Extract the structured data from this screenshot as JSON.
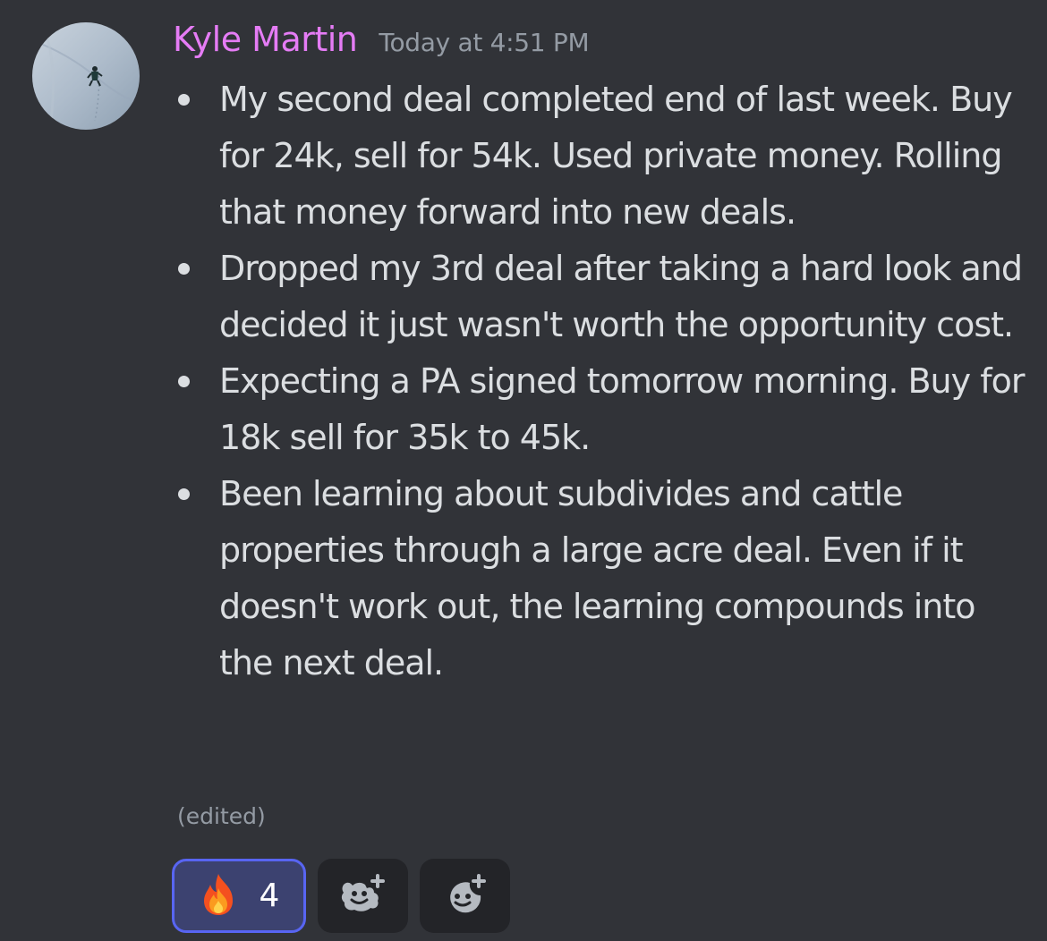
{
  "message": {
    "author": "Kyle Martin",
    "timestamp": "Today at 4:51 PM",
    "edited_label": "(edited)",
    "author_color": "#e57cf5",
    "bullets": [
      {
        "text": "My second deal completed end of last week. Buy for 24k, sell for 54k. Used private money. Rolling that money forward into new deals."
      },
      {
        "text": "Dropped my 3rd deal after taking a hard look and decided it just wasn't worth the opportunity cost."
      },
      {
        "text": "Expecting a PA signed tomorrow morning. Buy for 18k sell for 35k to 45k."
      },
      {
        "text": "Been learning about subdivides and cattle properties through a large acre deal. Even if it doesn't work out, the learning compounds into the next deal."
      }
    ]
  },
  "reactions": [
    {
      "icon": "fire-icon",
      "count": "4",
      "active": true
    },
    {
      "icon": "add-super-reaction-icon"
    },
    {
      "icon": "add-reaction-icon"
    }
  ],
  "colors": {
    "background": "#313338",
    "text": "#dbdee1",
    "muted": "#949ba4",
    "reaction_active_border": "#5865f2",
    "reaction_active_bg": "#3c4270"
  }
}
